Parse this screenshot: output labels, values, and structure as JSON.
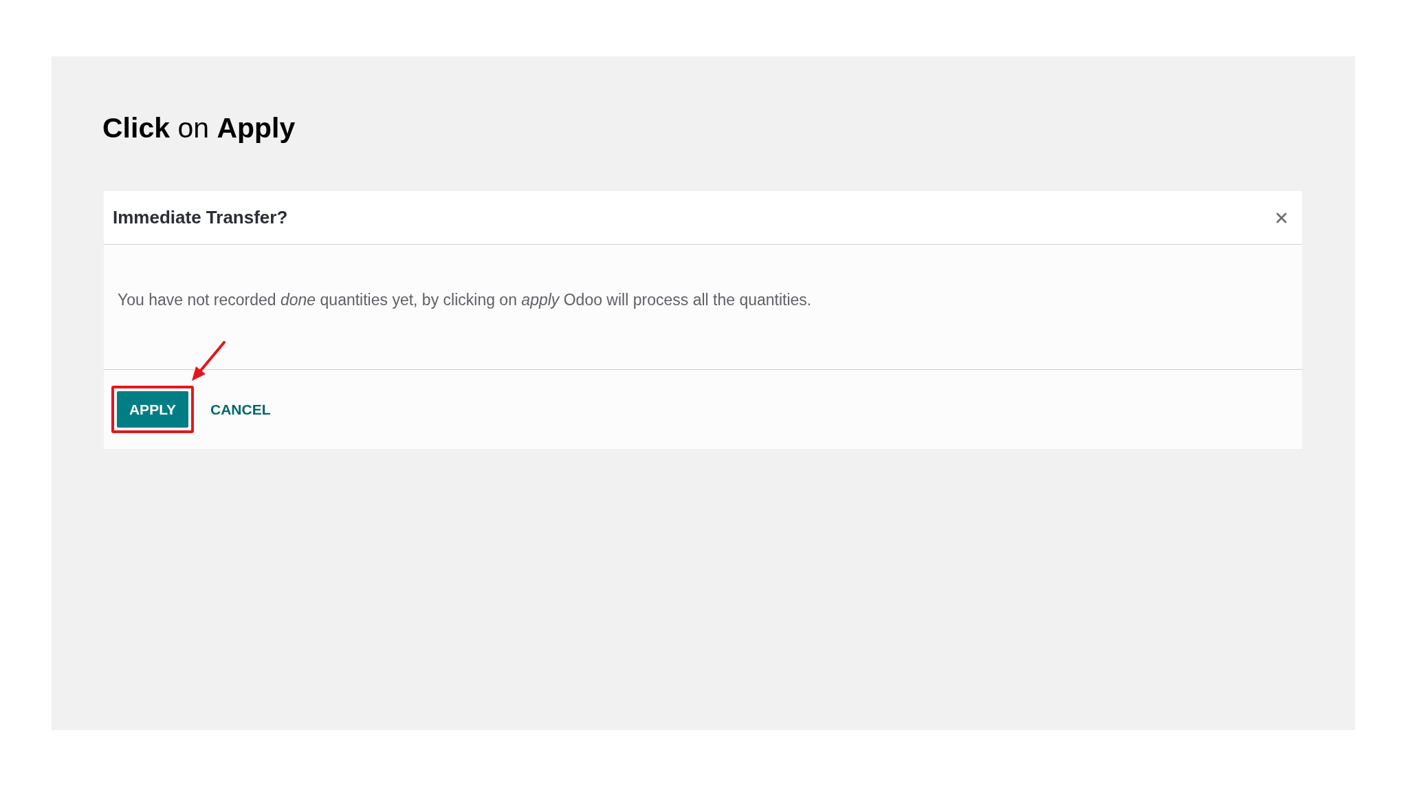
{
  "heading": "**Click** on **Apply**",
  "dialog": {
    "title": "Immediate Transfer?",
    "message": "You have not recorded *done* quantities yet, by clicking on *apply* Odoo will process all the quantities.",
    "buttons": [
      {
        "label": "APPLY",
        "kind": "primary",
        "highlighted": true
      },
      {
        "label": "CANCEL",
        "kind": "link",
        "highlighted": false
      }
    ]
  }
}
